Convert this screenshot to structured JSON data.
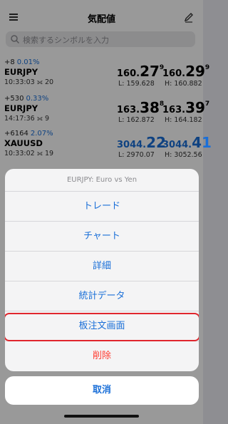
{
  "nav": {
    "title": "気配値"
  },
  "search": {
    "placeholder": "検索するシンボルを入力"
  },
  "quotes": [
    {
      "change": "+8",
      "change_pct": "0.01%",
      "symbol": "EURJPY",
      "time": "10:33:03",
      "spread": "20",
      "bid": {
        "main": "160.",
        "big": "27",
        "sup": "9"
      },
      "ask": {
        "main": "160.",
        "big": "29",
        "sup": "9"
      },
      "low": "L: 159.628",
      "high": "H: 160.882",
      "blue": false
    },
    {
      "change": "+530",
      "change_pct": "0.33%",
      "symbol": "EURJPY",
      "time": "14:17:36",
      "spread": "9",
      "bid": {
        "main": "163.",
        "big": "38",
        "sup": "8"
      },
      "ask": {
        "main": "163.",
        "big": "39",
        "sup": "7"
      },
      "low": "L: 162.872",
      "high": "H: 164.182",
      "blue": false
    },
    {
      "change": "+6164",
      "change_pct": "2.07%",
      "symbol": "XAUUSD",
      "time": "10:33:02",
      "spread": "19",
      "bid": {
        "main": "3044.",
        "big": "22",
        "sup": ""
      },
      "ask": {
        "main": "3044.",
        "big": "41",
        "sup": ""
      },
      "low": "L: 2970.07",
      "high": "H: 3052.56",
      "blue": true
    }
  ],
  "sheet": {
    "header": "EURJPY: Euro vs Yen",
    "items": [
      "トレード",
      "チャート",
      "詳細",
      "統計データ",
      "板注文画面",
      "削除"
    ],
    "cancel": "取消"
  },
  "colors": {
    "accent": "#1a6fd8",
    "destructive": "#ff3b30",
    "highlight": "#e0262d"
  }
}
